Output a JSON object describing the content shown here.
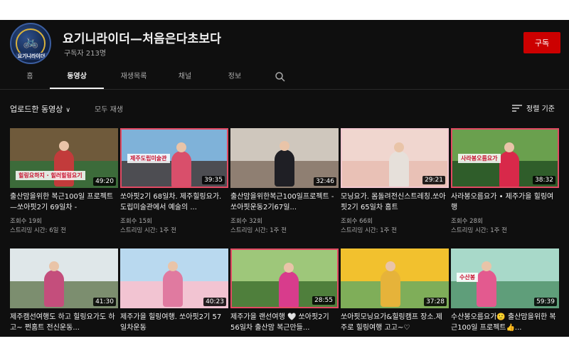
{
  "channel": {
    "name": "요기니라이더—처음은다초보다",
    "subscribers": "구독자 213명",
    "subscribe_label": "구독",
    "avatar_text": "요기니라이더"
  },
  "tabs": [
    "홈",
    "동영상",
    "재생목록",
    "채널",
    "정보"
  ],
  "active_tab": "동영상",
  "filter": {
    "uploads_label": "업로드한 동영상",
    "play_all_label": "모두 재생",
    "sort_label": "정렬 기준"
  },
  "videos": [
    {
      "title": "출산맘을위한 복근100일 프로젝트 —쏘아핏2기 69일차 -",
      "views": "조회수 19회",
      "streamed": "스트리밍 시간: 6일 전",
      "duration": "49:20",
      "thumb_text": "힐링요하지 · 힐러힐링요기",
      "colors": [
        "#6f5a3b",
        "#3c6b3a",
        "#c23b3b"
      ]
    },
    {
      "title": "쏘아핏2기 68일차. 제주힐링요가.도립미술관에서 예술의 ...",
      "views": "조회수 15회",
      "streamed": "스트리밍 시간: 1주 전",
      "duration": "39:35",
      "thumb_text": "제주도립미술관",
      "colors": [
        "#7fb2d9",
        "#4d4d52",
        "#d94f6b"
      ]
    },
    {
      "title": "출산맘을위한복근100일프로젝트 - 쏘아핏운동2기67일...",
      "views": "조회수 32회",
      "streamed": "스트리밍 시간: 1주 전",
      "duration": "32:46",
      "thumb_text": "",
      "colors": [
        "#cfc7bd",
        "#8f7f72",
        "#1f1f25"
      ]
    },
    {
      "title": "모닝요가. 몸돌려전신스트레칭.쏘아핏2기 65일차 홈트",
      "views": "조회수 66회",
      "streamed": "스트리밍 시간: 1주 전",
      "duration": "29:21",
      "thumb_text": "",
      "colors": [
        "#f0d6cf",
        "#e9c1b6",
        "#e6e0da"
      ]
    },
    {
      "title": "사라봉오름요가 • 제주가을 힐링여행",
      "views": "조회수 28회",
      "streamed": "스트리밍 시간: 1주 전",
      "duration": "38:32",
      "thumb_text": "사라봉오름요가",
      "colors": [
        "#6aa04e",
        "#2f5d2a",
        "#d8294a"
      ]
    },
    {
      "title": "제주캠선여행도 하고 힐링요가도 하고~ 쩐홈트 전신운동...",
      "views": "",
      "streamed": "",
      "duration": "41:30",
      "thumb_text": "",
      "colors": [
        "#dfe7e9",
        "#7c8e6f",
        "#c44e7c"
      ]
    },
    {
      "title": "제주가을 힐링여행. 쏘아핏2기 57일차운동",
      "views": "",
      "streamed": "",
      "duration": "40:23",
      "thumb_text": "",
      "colors": [
        "#b9d9ef",
        "#f2c4d2",
        "#e07aa0"
      ]
    },
    {
      "title": "제주가을 랜선여행 🤍 쏘아핏2기56일차 출산맘 복근만들...",
      "views": "",
      "streamed": "",
      "duration": "28:55",
      "thumb_text": "",
      "colors": [
        "#9ec77a",
        "#4f7f3c",
        "#d83c8c"
      ]
    },
    {
      "title": "쏘아핏모닝요가&힐링캠프 장소.제주로 힐링여행 고고~♡",
      "views": "",
      "streamed": "",
      "duration": "37:28",
      "thumb_text": "",
      "colors": [
        "#f2c12e",
        "#7fae59",
        "#e6b33a"
      ]
    },
    {
      "title": "수산봉오름요가🙂 출산맘을위한 복근100일 프로젝트👍...",
      "views": "",
      "streamed": "",
      "duration": "59:39",
      "thumb_text": "수산봉",
      "colors": [
        "#a8d9c9",
        "#5f9e7a",
        "#e35a8f"
      ]
    }
  ]
}
